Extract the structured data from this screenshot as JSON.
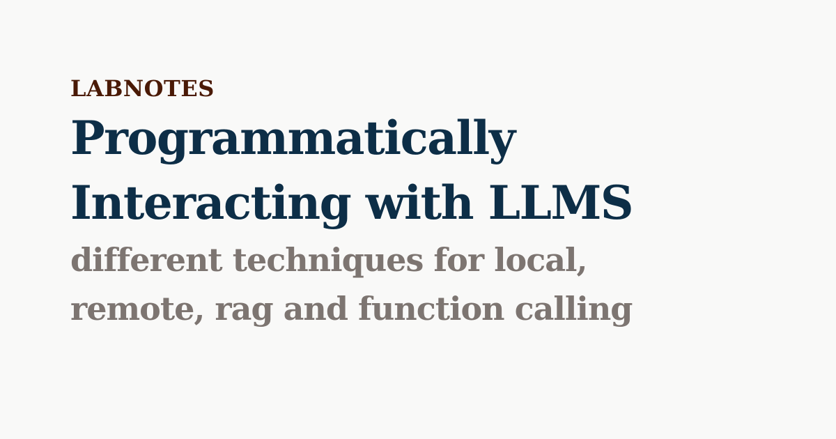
{
  "kicker": "LABNOTES",
  "title_lines": [
    "Programmatically",
    "Interacting with LLMS"
  ],
  "subtitle_lines": [
    "different techniques for local,",
    "remote, rag and function calling"
  ],
  "colors": {
    "background": "#f9f9f8",
    "kicker": "#4a1a06",
    "title": "#0d2e47",
    "subtitle": "#7d7571"
  }
}
